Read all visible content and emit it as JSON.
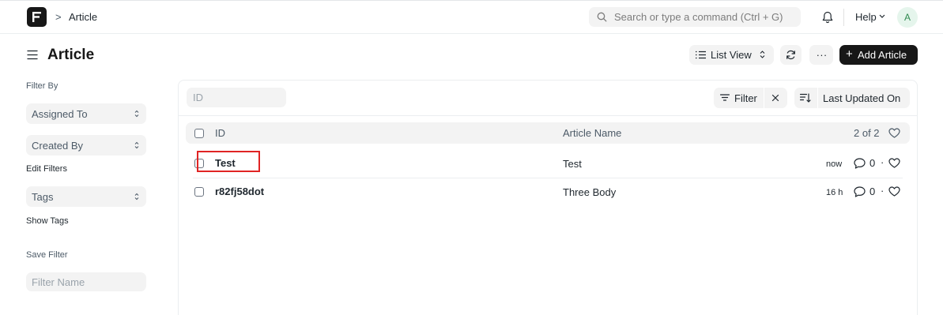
{
  "navbar": {
    "breadcrumb": "Article",
    "breadcrumb_separator": ">",
    "search_placeholder": "Search or type a command (Ctrl + G)",
    "help_label": "Help",
    "avatar_initial": "A"
  },
  "page": {
    "title": "Article",
    "list_view_label": "List View",
    "more_label": "...",
    "add_button_label": "Add Article",
    "add_button_plus": "+"
  },
  "sidebar": {
    "filter_by_label": "Filter By",
    "assigned_to_label": "Assigned To",
    "created_by_label": "Created By",
    "edit_filters_label": "Edit Filters",
    "tags_label": "Tags",
    "show_tags_label": "Show Tags",
    "save_filter_label": "Save Filter",
    "filter_name_placeholder": "Filter Name"
  },
  "list": {
    "id_placeholder": "ID",
    "filter_label": "Filter",
    "sort_label": "Last Updated On",
    "columns": {
      "id": "ID",
      "name": "Article Name",
      "count": "2 of 2"
    },
    "rows": [
      {
        "id": "Test",
        "name": "Test",
        "time": "now",
        "comments": "0",
        "separator": "·"
      },
      {
        "id": "r82fj58dot",
        "name": "Three Body",
        "time": "16 h",
        "comments": "0",
        "separator": "·"
      }
    ]
  },
  "colors": {
    "primary_button": "#171717",
    "highlight_box": "#e02424",
    "avatar_bg": "#e5f5ec"
  }
}
